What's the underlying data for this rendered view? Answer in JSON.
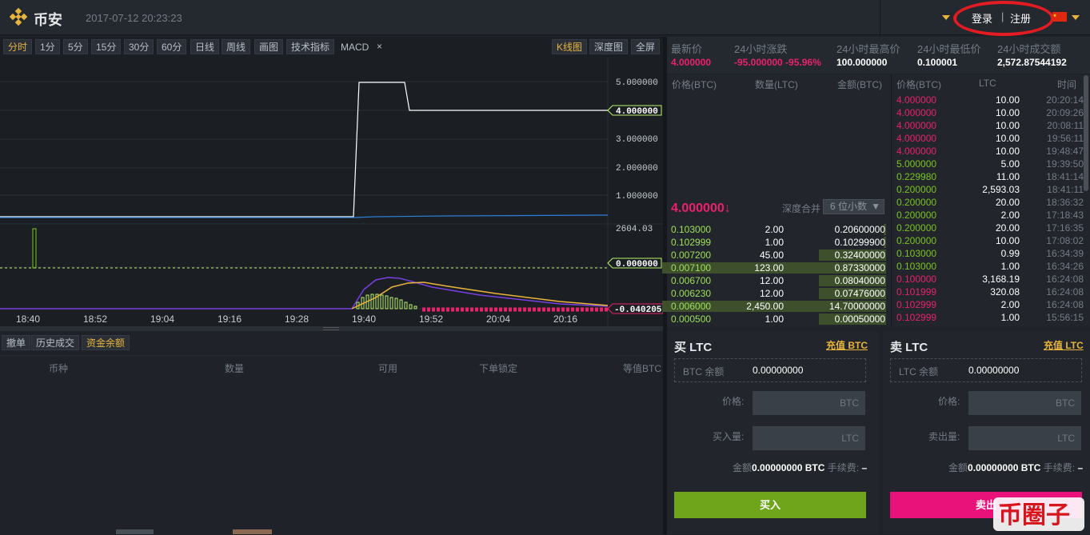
{
  "header": {
    "brand": "币安",
    "datetime": "2017-07-12 20:23:23",
    "login": "登录",
    "separator": "|",
    "register": "注册"
  },
  "chart_toolbar": {
    "items": [
      "分时",
      "1分",
      "5分",
      "15分",
      "30分",
      "60分",
      "日线",
      "周线",
      "画图",
      "技术指标"
    ],
    "indicator": "MACD",
    "close": "×",
    "views": [
      "K线图",
      "深度图",
      "全屏"
    ]
  },
  "chart": {
    "price_ticks": [
      "5.000000",
      "4.000000",
      "3.000000",
      "2.000000",
      "1.000000"
    ],
    "price_tag": "4.000000",
    "volume_tick": "2604.03",
    "volume_tag": "0.000000",
    "macd_tag": "-0.040205",
    "time_ticks": [
      "18:40",
      "18:52",
      "19:04",
      "19:16",
      "19:28",
      "19:40",
      "19:52",
      "20:04",
      "20:16"
    ]
  },
  "bottom_tabs": [
    "撤单",
    "历史成交",
    "资金余额"
  ],
  "balance_table": {
    "headers": [
      "币种",
      "数量",
      "可用",
      "下单锁定",
      "等值BTC"
    ]
  },
  "market": {
    "labels": [
      "最新价",
      "24小时涨跌",
      "24小时最高价",
      "24小时最低价",
      "24小时成交额"
    ],
    "latest": "4.000000",
    "change": "-95.000000 -95.96%",
    "high": "100.000000",
    "low": "0.100001",
    "volume": "2,572.87544192"
  },
  "orderbook": {
    "headers": [
      "价格(BTC)",
      "数量(LTC)",
      "金额(BTC)"
    ],
    "last_price": "4.000000",
    "arrow": "↓",
    "depth_label": "深度合并",
    "depth_value": "6 位小数",
    "bids": [
      {
        "price": "0.103000",
        "qty": "2.00",
        "amount": "0.20600000",
        "depth": 0.01
      },
      {
        "price": "0.102999",
        "qty": "1.00",
        "amount": "0.10299900",
        "depth": 0.01
      },
      {
        "price": "0.007200",
        "qty": "45.00",
        "amount": "0.32400000",
        "depth": 0.3
      },
      {
        "price": "0.007100",
        "qty": "123.00",
        "amount": "0.87330000",
        "depth": 1.0
      },
      {
        "price": "0.006700",
        "qty": "12.00",
        "amount": "0.08040000",
        "depth": 0.3
      },
      {
        "price": "0.006230",
        "qty": "12.00",
        "amount": "0.07476000",
        "depth": 0.3
      },
      {
        "price": "0.006000",
        "qty": "2,450.00",
        "amount": "14.70000000",
        "depth": 1.0
      },
      {
        "price": "0.000500",
        "qty": "1.00",
        "amount": "0.00050000",
        "depth": 0.3
      }
    ]
  },
  "trades": {
    "headers": [
      "价格(BTC)",
      "LTC",
      "时间"
    ],
    "rows": [
      {
        "price": "4.000000",
        "qty": "10.00",
        "time": "20:20:14",
        "side": "sell"
      },
      {
        "price": "4.000000",
        "qty": "10.00",
        "time": "20:09:26",
        "side": "sell"
      },
      {
        "price": "4.000000",
        "qty": "10.00",
        "time": "20:08:11",
        "side": "sell"
      },
      {
        "price": "4.000000",
        "qty": "10.00",
        "time": "19:56:11",
        "side": "sell"
      },
      {
        "price": "4.000000",
        "qty": "10.00",
        "time": "19:48:47",
        "side": "sell"
      },
      {
        "price": "5.000000",
        "qty": "5.00",
        "time": "19:39:50",
        "side": "buy"
      },
      {
        "price": "0.229980",
        "qty": "11.00",
        "time": "18:41:14",
        "side": "buy"
      },
      {
        "price": "0.200000",
        "qty": "2,593.03",
        "time": "18:41:11",
        "side": "buy"
      },
      {
        "price": "0.200000",
        "qty": "20.00",
        "time": "18:36:32",
        "side": "buy"
      },
      {
        "price": "0.200000",
        "qty": "2.00",
        "time": "17:18:43",
        "side": "buy"
      },
      {
        "price": "0.200000",
        "qty": "20.00",
        "time": "17:16:35",
        "side": "buy"
      },
      {
        "price": "0.200000",
        "qty": "10.00",
        "time": "17:08:02",
        "side": "buy"
      },
      {
        "price": "0.103000",
        "qty": "0.99",
        "time": "16:34:39",
        "side": "buy"
      },
      {
        "price": "0.103000",
        "qty": "1.00",
        "time": "16:34:26",
        "side": "buy"
      },
      {
        "price": "0.100000",
        "qty": "3,168.19",
        "time": "16:24:08",
        "side": "sell"
      },
      {
        "price": "0.101999",
        "qty": "320.08",
        "time": "16:24:08",
        "side": "sell"
      },
      {
        "price": "0.102999",
        "qty": "2.00",
        "time": "16:24:08",
        "side": "sell"
      },
      {
        "price": "0.102999",
        "qty": "1.00",
        "time": "15:56:15",
        "side": "sell"
      }
    ]
  },
  "buy_form": {
    "title": "买 LTC",
    "deposit": "充值 BTC",
    "balance_label": "BTC 余额",
    "balance": "0.00000000",
    "price_label": "价格:",
    "price_unit": "BTC",
    "qty_label": "买入量:",
    "qty_unit": "LTC",
    "amount_label": "金额",
    "amount": "0.00000000 BTC",
    "fee_label": "手续费:",
    "fee": "–",
    "submit": "买入"
  },
  "sell_form": {
    "title": "卖 LTC",
    "deposit": "充值 LTC",
    "balance_label": "LTC 余额",
    "balance": "0.00000000",
    "price_label": "价格:",
    "price_unit": "BTC",
    "qty_label": "卖出量:",
    "qty_unit": "LTC",
    "amount_label": "金额",
    "amount": "0.00000000 BTC",
    "fee_label": "手续费:",
    "fee": "–",
    "submit": "卖出"
  },
  "watermark": "币圈子",
  "colors": {
    "up": "#79c41c",
    "down": "#e8226d",
    "accent": "#e8b53a",
    "buy_button": "#6fa51a",
    "sell_button": "#e8127a"
  }
}
